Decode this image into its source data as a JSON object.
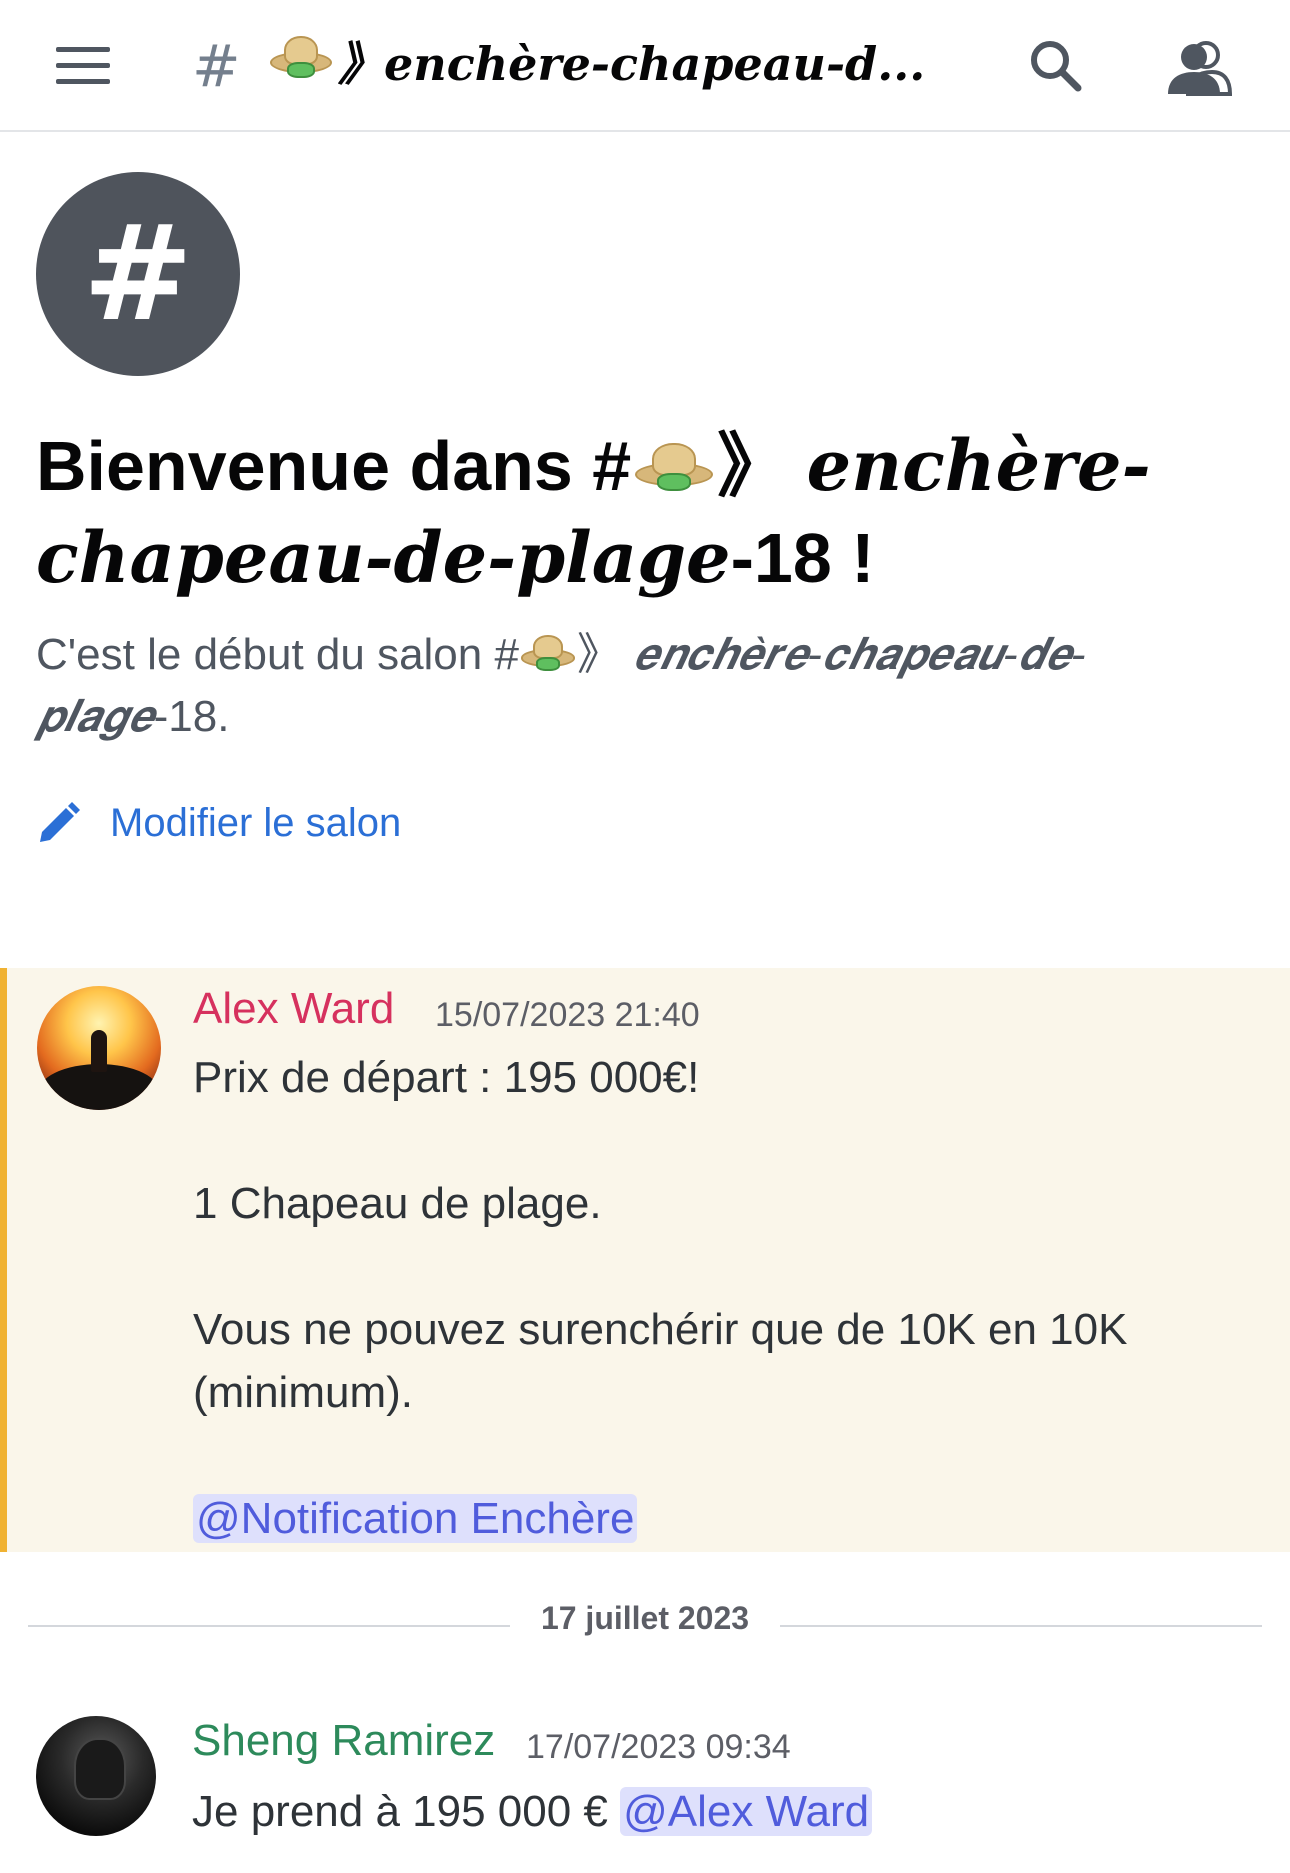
{
  "header": {
    "channel_prefix": "#",
    "channel_name": "》𝒆𝒏𝒄𝒉𝒆̀𝒓𝒆-𝒄𝒉𝒂𝒑𝒆𝒂𝒖-𝒅...",
    "menu_icon": "hamburger-menu-icon",
    "search_icon": "search-icon",
    "members_icon": "members-icon"
  },
  "welcome": {
    "prefix": "Bienvenue dans #",
    "bracket": "》",
    "fancy1": "𝒆𝒏𝒄𝒉𝒆̀𝒓𝒆-",
    "fancy2": "𝒄𝒉𝒂𝒑𝒆𝒂𝒖-𝒅𝒆-𝒑𝒍𝒂𝒈𝒆",
    "suffix": "-18 !"
  },
  "description": {
    "prefix": "C'est le début du salon #",
    "bracket": "》",
    "fancy1": "𝒆𝒏𝒄𝒉𝒆̀𝒓𝒆-𝒄𝒉𝒂𝒑𝒆𝒂𝒖-𝒅𝒆-",
    "fancy2": "𝒑𝒍𝒂𝒈𝒆",
    "suffix": "-18."
  },
  "edit_channel": {
    "label": "Modifier le salon"
  },
  "messages": [
    {
      "author": "Alex Ward",
      "timestamp": "15/07/2023 21:40",
      "author_color": "#d6315e",
      "highlighted": true,
      "lines": [
        "Prix de départ : 195 000€!",
        "1 Chapeau de plage.",
        "Vous ne pouvez surenchérir que de 10K en 10K (minimum)."
      ],
      "mention": "@Notification Enchère"
    },
    {
      "author": "Sheng Ramirez",
      "timestamp": "17/07/2023 09:34",
      "author_color": "#2d8a5b",
      "text": "Je prend à 195 000 €",
      "mention": "@Alex Ward"
    }
  ],
  "date_divider": "17 juillet 2023",
  "colors": {
    "accent_link": "#2b6fd6",
    "mention_bg": "#dee0fc",
    "mention_text": "#505cdc",
    "highlight_bg": "#faf6ea",
    "highlight_bar": "#f0b232"
  }
}
